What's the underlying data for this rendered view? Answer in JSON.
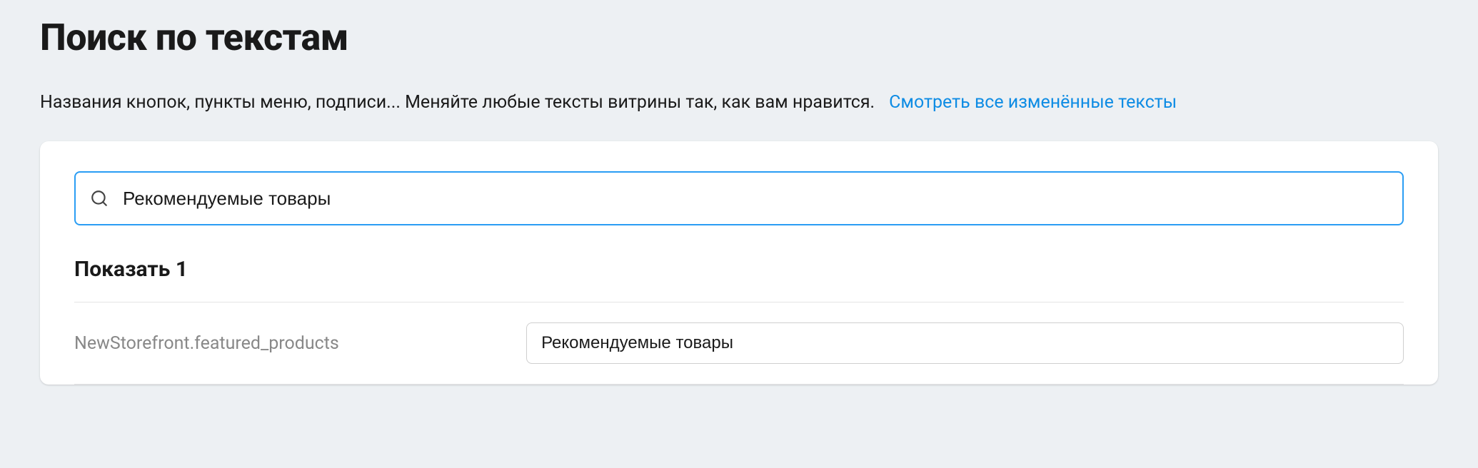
{
  "header": {
    "title": "Поиск по текстам",
    "description": "Названия кнопок, пункты меню, подписи... Меняйте любые тексты витрины так, как вам нравится.",
    "link_label": "Смотреть все изменённые тексты"
  },
  "search": {
    "value": "Рекомендуемые товары"
  },
  "results": {
    "header": "Показать 1",
    "items": [
      {
        "key": "NewStorefront.featured_products",
        "value": "Рекомендуемые товары"
      }
    ]
  }
}
